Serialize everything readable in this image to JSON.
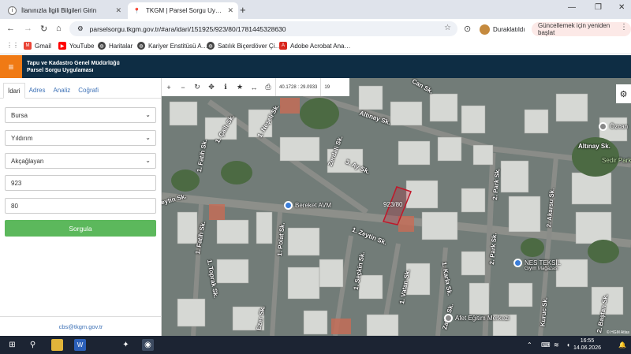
{
  "browser": {
    "tabs": [
      {
        "title": "İlanınızla İlgili Bilgileri Girin",
        "active": false
      },
      {
        "title": "TKGM | Parsel Sorgu Uygulama…",
        "active": true
      }
    ],
    "url": "parselsorgu.tkgm.gov.tr/#ara/idari/151925/923/80/1781445328630",
    "profile_label": "Duraklatıldı",
    "update_label": "Güncellemek için yeniden başlat",
    "bookmarks": [
      "Gmail",
      "YouTube",
      "Haritalar",
      "Kariyer Enstitüsü A…",
      "Satılık Biçerdöver Çi…",
      "Adobe Acrobat Ana…"
    ]
  },
  "app": {
    "title_line1": "Tapu ve Kadastro Genel Müdürlüğü",
    "title_line2": "Parsel Sorgu Uygulaması"
  },
  "sidebar": {
    "tabs": [
      "İdari",
      "Adres",
      "Analiz",
      "Coğrafi"
    ],
    "active_tab": "İdari",
    "province": "Bursa",
    "district": "Yıldırım",
    "neighborhood": "Akçağlayan",
    "block": "923",
    "parcel": "80",
    "submit_label": "Sorgula",
    "footer_email": "cbs@tkgm.gov.tr"
  },
  "map": {
    "coords": "40.1728 : 29.0933",
    "zoom": "19",
    "parcel_label": "923/80",
    "streets": [
      "Can Sk.",
      "1. Neşeli Sk.",
      "1. Çallı Sk.",
      "Altınay Sk.",
      "Zerdali Sk.",
      "3. Ay Sk.",
      "1. Fatih Sk.",
      "Zeytin Sk.",
      "1. Zeytin Sk.",
      "1. Polat Sk.",
      "1. Fatih Sk.",
      "1. Toprak Sk.",
      "1. Seçkin Sk.",
      "1. Vatan Sk.",
      "1. Karla Sk.",
      "2. Park Sk.",
      "2. Akarsu Sk.",
      "Altınay Sk.",
      "2. Park Sk.",
      "Kuruc Sk.",
      "2. Baştan Sk.",
      "Zafer Sk.",
      "Ezer Sk."
    ],
    "pois": [
      "Bereket AVM",
      "Özcan",
      "Sedir Parkı",
      "NES TEKSİL",
      "Giyim Mağazası",
      "Afet Eğitim Merkezi"
    ],
    "attribution": "© HGM Atlas"
  },
  "taskbar": {
    "time": "16:55",
    "date": "14.06.2026"
  },
  "colors": {
    "header": "#0e2d44",
    "accent": "#f07a14",
    "submit": "#5cb85c",
    "parcel_outline": "#c0182a"
  }
}
